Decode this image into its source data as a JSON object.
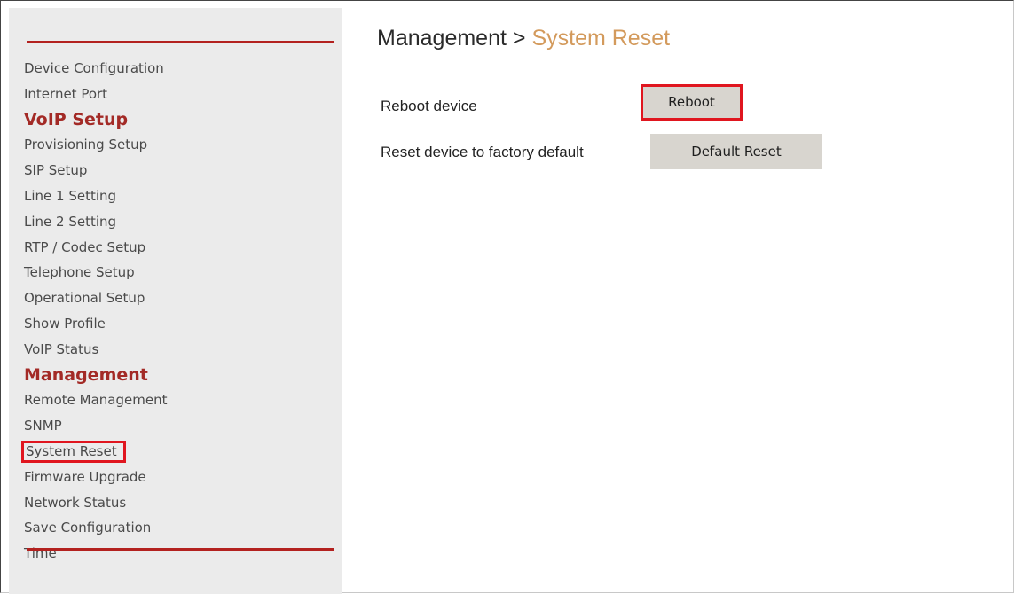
{
  "sidebar": {
    "items": [
      {
        "label": "Device Configuration",
        "type": "link"
      },
      {
        "label": "Internet Port",
        "type": "link"
      },
      {
        "label": "VoIP Setup",
        "type": "section"
      },
      {
        "label": "Provisioning Setup",
        "type": "link"
      },
      {
        "label": "SIP Setup",
        "type": "link"
      },
      {
        "label": "Line 1 Setting",
        "type": "link"
      },
      {
        "label": "Line 2 Setting",
        "type": "link"
      },
      {
        "label": "RTP / Codec Setup",
        "type": "link"
      },
      {
        "label": "Telephone Setup",
        "type": "link"
      },
      {
        "label": "Operational Setup",
        "type": "link"
      },
      {
        "label": "Show Profile",
        "type": "link"
      },
      {
        "label": "VoIP Status",
        "type": "link"
      },
      {
        "label": "Management",
        "type": "section"
      },
      {
        "label": "Remote Management",
        "type": "link"
      },
      {
        "label": "SNMP",
        "type": "link"
      },
      {
        "label": "System Reset",
        "type": "link",
        "current": true
      },
      {
        "label": "Firmware Upgrade",
        "type": "link"
      },
      {
        "label": "Network Status",
        "type": "link"
      },
      {
        "label": "Save Configuration",
        "type": "link"
      },
      {
        "label": "Time",
        "type": "link"
      }
    ]
  },
  "header": {
    "section": "Management",
    "separator": ">",
    "page": "System Reset"
  },
  "actions": {
    "reboot": {
      "label": "Reboot device",
      "button": "Reboot"
    },
    "factory_reset": {
      "label": "Reset device to factory default",
      "button": "Default Reset"
    }
  },
  "colors": {
    "section_heading": "#a32a26",
    "accent_rule": "#b3211f",
    "breadcrumb_current": "#d39a5c",
    "highlight_box": "#e0161f",
    "button_face": "#d8d5cf",
    "sidebar_background": "#ebebeb"
  }
}
